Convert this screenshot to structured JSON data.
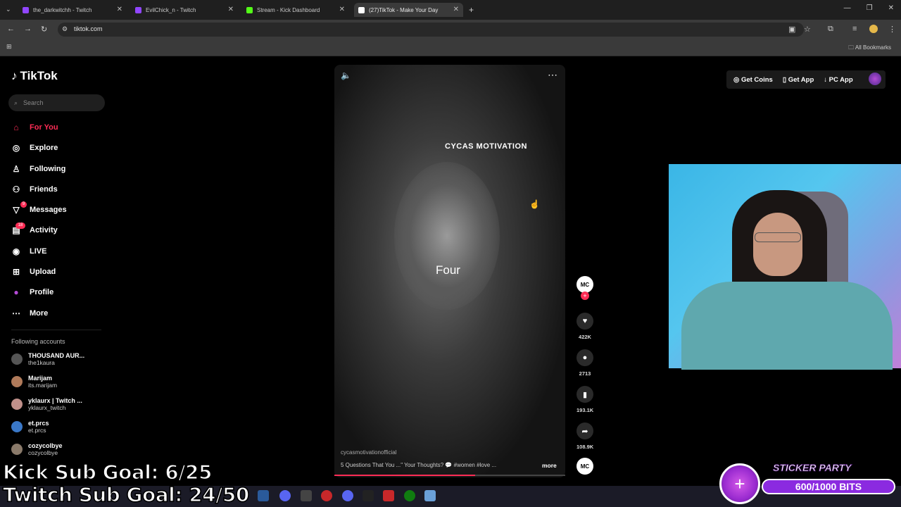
{
  "browser": {
    "tabs": [
      {
        "title": "the_darkwitchh - Twitch",
        "color": "#9146ff"
      },
      {
        "title": "EvilChick_n - Twitch",
        "color": "#9146ff"
      },
      {
        "title": "Stream - Kick Dashboard",
        "color": "#53fc18"
      },
      {
        "title": "(27)TikTok - Make Your Day",
        "color": "#ffffff"
      }
    ],
    "url": "tiktok.com",
    "all_bookmarks": "All Bookmarks"
  },
  "tiktok": {
    "logo": "TikTok",
    "search_placeholder": "Search",
    "nav": [
      {
        "label": "For You",
        "icon": "home-icon"
      },
      {
        "label": "Explore",
        "icon": "compass-icon"
      },
      {
        "label": "Following",
        "icon": "person-icon"
      },
      {
        "label": "Friends",
        "icon": "friends-icon"
      },
      {
        "label": "Messages",
        "icon": "message-icon",
        "badge": "9"
      },
      {
        "label": "Activity",
        "icon": "activity-icon",
        "badge": "18"
      },
      {
        "label": "LIVE",
        "icon": "live-icon"
      },
      {
        "label": "Upload",
        "icon": "upload-icon"
      },
      {
        "label": "Profile",
        "icon": "profile-icon"
      },
      {
        "label": "More",
        "icon": "more-icon"
      }
    ],
    "following_title": "Following accounts",
    "following": [
      {
        "name": "THOUSAND AUR...",
        "handle": "the1kaura"
      },
      {
        "name": "Marijam",
        "handle": "its.marijam"
      },
      {
        "name": "yklaurx | Twitch ...",
        "handle": "yklaurx_twitch"
      },
      {
        "name": "et.prcs",
        "handle": "et.prcs"
      },
      {
        "name": "cozycolbye",
        "handle": "cozycolbye"
      }
    ],
    "video": {
      "title": "CYCAS MOTIVATION",
      "caption": "Four",
      "username": "cycasmotivationofficial",
      "description": "5 Questions That You ...\" Your Thoughts? 💬 #women #love ...",
      "more": "more",
      "progress": 0.61,
      "likes": "422K",
      "comments": "2713",
      "saves": "193.1K",
      "shares": "108.9K",
      "creator_initials": "MC"
    },
    "topbar": {
      "get_coins": "Get Coins",
      "get_app": "Get App",
      "pc_app": "PC App"
    }
  },
  "overlay": {
    "kick_goal": "Kick Sub Goal: 6/25",
    "twitch_goal": "Twitch Sub Goal: 24/50",
    "sticker_title": "STICKER PARTY",
    "bits": "600/1000 BITS"
  },
  "colors": {
    "accent": "#fe2c55",
    "bits": "#8b2ae0"
  }
}
